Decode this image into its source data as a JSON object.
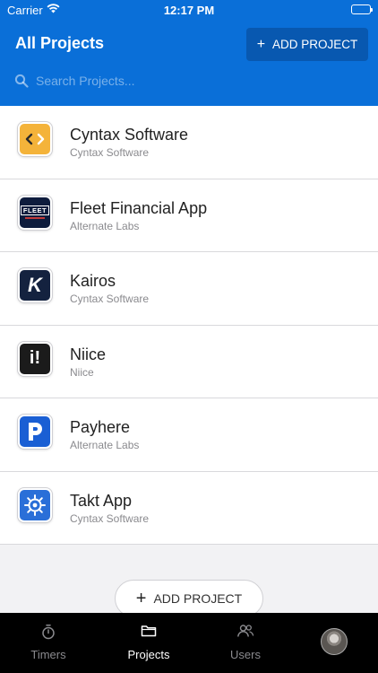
{
  "status_bar": {
    "carrier": "Carrier",
    "time": "12:17 PM"
  },
  "header": {
    "title": "All Projects",
    "add_button_label": "ADD PROJECT",
    "search_placeholder": "Search Projects..."
  },
  "projects": [
    {
      "name": "Cyntax Software",
      "company": "Cyntax Software",
      "logo": "cyntax-logo",
      "logo_color": "#f4b33a"
    },
    {
      "name": "Fleet Financial App",
      "company": "Alternate Labs",
      "logo": "fleet-logo",
      "logo_color": "#0e1c3d",
      "logo_text": "FLEET"
    },
    {
      "name": "Kairos",
      "company": "Cyntax Software",
      "logo": "kairos-logo",
      "logo_color": "#14223f",
      "logo_text": "K"
    },
    {
      "name": "Niice",
      "company": "Niice",
      "logo": "niice-logo",
      "logo_color": "#1b1b1b",
      "logo_text": "i!"
    },
    {
      "name": "Payhere",
      "company": "Alternate Labs",
      "logo": "payhere-logo",
      "logo_color": "#1a5fd4"
    },
    {
      "name": "Takt App",
      "company": "Cyntax Software",
      "logo": "takt-logo",
      "logo_color": "#2a6fd8"
    }
  ],
  "footer": {
    "add_button_label": "ADD PROJECT"
  },
  "tabbar": {
    "tabs": [
      {
        "label": "Timers",
        "icon": "stopwatch-icon",
        "active": false
      },
      {
        "label": "Projects",
        "icon": "folder-icon",
        "active": true
      },
      {
        "label": "Users",
        "icon": "users-icon",
        "active": false
      }
    ],
    "avatar": "user-avatar"
  },
  "colors": {
    "accent": "#0a6fd8",
    "accent_dark": "#0858b0",
    "tabbar": "#000000"
  }
}
